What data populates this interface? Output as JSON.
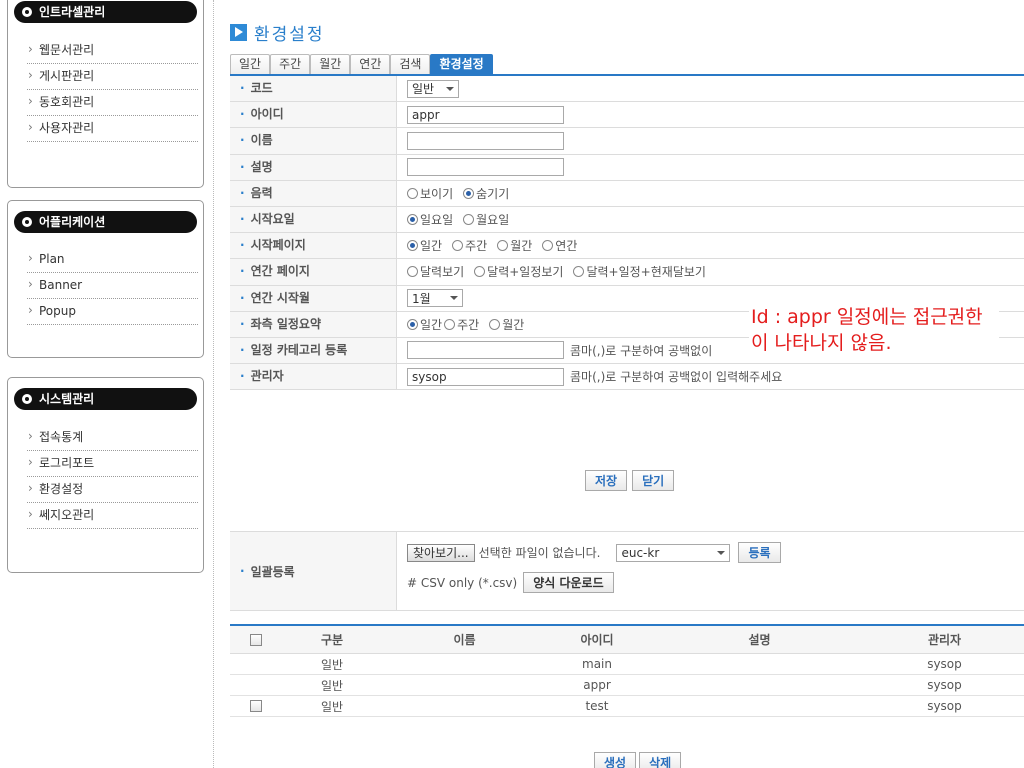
{
  "sidebar": {
    "sections": [
      {
        "title": "인트라셀관리",
        "items": [
          "웹문서관리",
          "게시판관리",
          "동호회관리",
          "사용자관리"
        ]
      },
      {
        "title": "어플리케이션",
        "items": [
          "Plan",
          "Banner",
          "Popup"
        ]
      },
      {
        "title": "시스템관리",
        "items": [
          "접속통계",
          "로그리포트",
          "환경설정",
          "쎄지오관리"
        ]
      }
    ]
  },
  "page": {
    "title": "환경설정"
  },
  "tabs": [
    "일간",
    "주간",
    "월간",
    "연간",
    "검색",
    "환경설정"
  ],
  "form": {
    "code": {
      "label": "코드",
      "value": "일반"
    },
    "id": {
      "label": "아이디",
      "value": "appr"
    },
    "name": {
      "label": "이름",
      "value": ""
    },
    "desc": {
      "label": "설명",
      "value": ""
    },
    "lunar": {
      "label": "음력",
      "options": [
        "보이기",
        "숨기기"
      ],
      "selected": "숨기기"
    },
    "start_day": {
      "label": "시작요일",
      "options": [
        "일요일",
        "월요일"
      ],
      "selected": "일요일"
    },
    "start_page": {
      "label": "시작페이지",
      "options": [
        "일간",
        "주간",
        "월간",
        "연간"
      ],
      "selected": "일간"
    },
    "year_page": {
      "label": "연간 페이지",
      "options": [
        "달력보기",
        "달력+일정보기",
        "달력+일정+현재달보기"
      ],
      "selected": ""
    },
    "year_start": {
      "label": "연간 시작월",
      "value": "1월"
    },
    "left_summary": {
      "label": "좌측 일정요약",
      "options": [
        "일간",
        "주간",
        "월간"
      ],
      "selected": "일간"
    },
    "category": {
      "label": "일정 카테고리 등록",
      "value": "",
      "hint": "콤마(,)로 구분하여 공백없이"
    },
    "admin": {
      "label": "관리자",
      "value": "sysop",
      "hint": "콤마(,)로 구분하여 공백없이 입력해주세요"
    }
  },
  "note": "Id : appr 일정에는 접근권한이 나타나지 않음.",
  "buttons": {
    "save": "저장",
    "close": "닫기",
    "create": "생성",
    "delete": "삭제"
  },
  "bulk": {
    "label": "일괄등록",
    "browse": "찾아보기...",
    "no_file": "선택한 파일이 없습니다.",
    "encoding": "euc-kr",
    "register": "등록",
    "csv_note": "# CSV only (*.csv)",
    "download": "양식 다운로드"
  },
  "list": {
    "headers": [
      "구분",
      "이름",
      "아이디",
      "설명",
      "관리자"
    ],
    "rows": [
      {
        "type": "일반",
        "name": "",
        "id": "main",
        "desc": "",
        "admin": "sysop",
        "checkbox": false
      },
      {
        "type": "일반",
        "name": "",
        "id": "appr",
        "desc": "",
        "admin": "sysop",
        "checkbox": false
      },
      {
        "type": "일반",
        "name": "",
        "id": "test",
        "desc": "",
        "admin": "sysop",
        "checkbox": true
      }
    ]
  }
}
